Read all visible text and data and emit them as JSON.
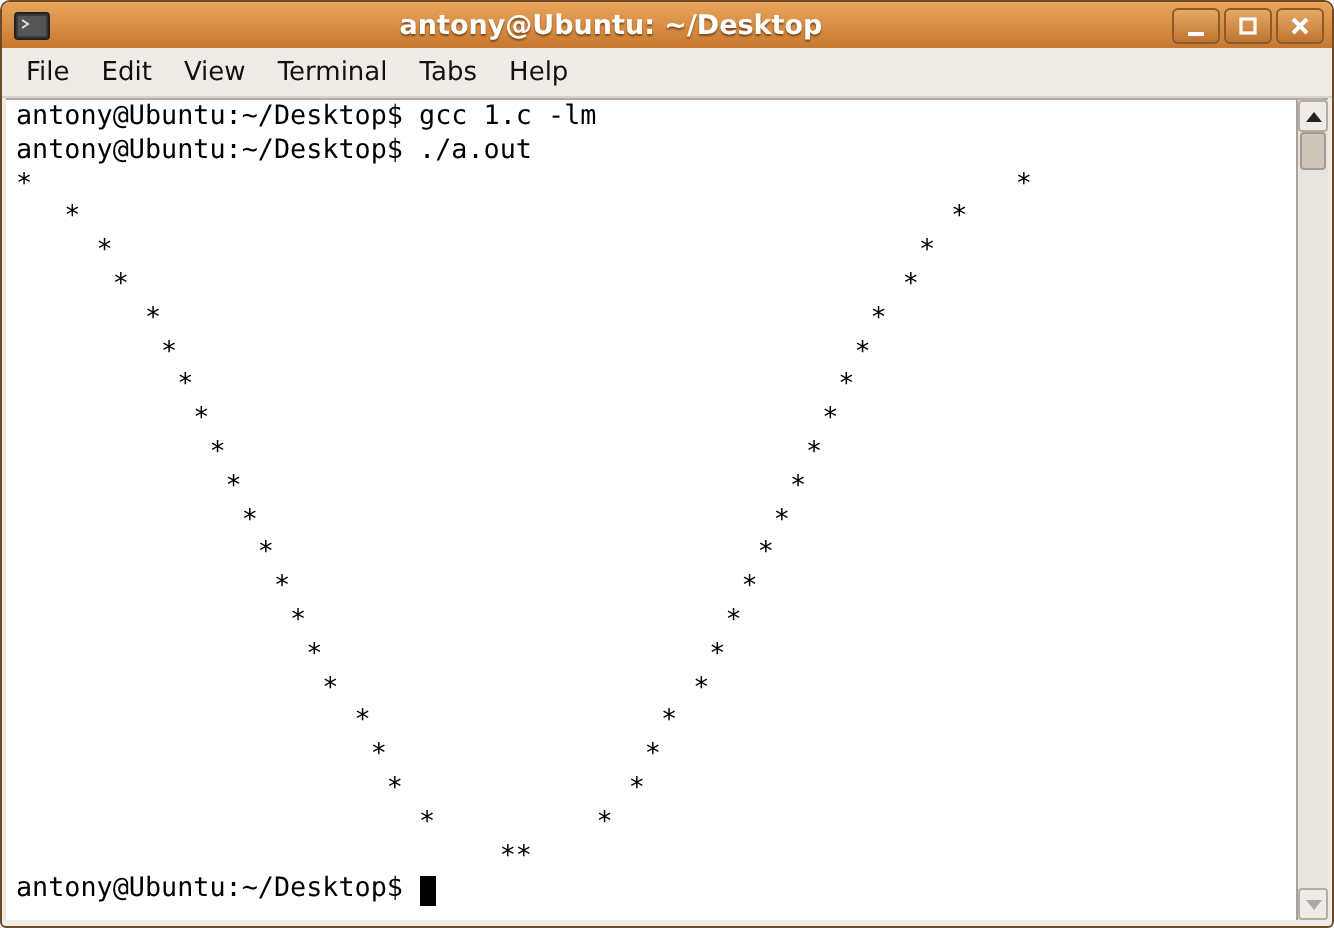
{
  "window": {
    "title": "antony@Ubuntu: ~/Desktop"
  },
  "menu": [
    {
      "label": "File"
    },
    {
      "label": "Edit"
    },
    {
      "label": "View"
    },
    {
      "label": "Terminal"
    },
    {
      "label": "Tabs"
    },
    {
      "label": "Help"
    }
  ],
  "terminal": {
    "lines": [
      "antony@Ubuntu:~/Desktop$ gcc 1.c -lm",
      "antony@Ubuntu:~/Desktop$ ./a.out",
      "*                                                             *",
      "   *                                                      *",
      "     *                                                  *",
      "      *                                                *",
      "        *                                            *",
      "         *                                          *",
      "          *                                        *",
      "           *                                      *",
      "            *                                    *",
      "             *                                  *",
      "              *                                *",
      "               *                              *",
      "                *                            *",
      "                 *                          *",
      "                  *                        *",
      "                   *                      *",
      "                     *                  *",
      "                      *                *",
      "                       *              *",
      "                         *          *",
      "                              **"
    ],
    "prompt": "antony@Ubuntu:~/Desktop$ "
  }
}
